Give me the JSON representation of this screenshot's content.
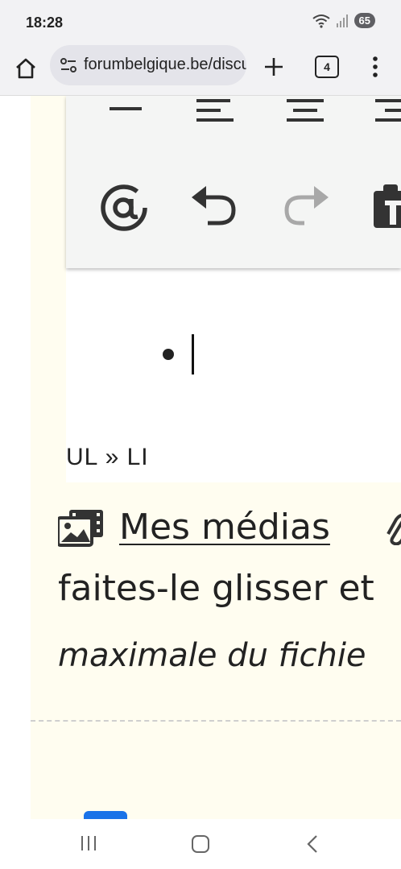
{
  "status_bar": {
    "time": "18:28",
    "battery": "65"
  },
  "browser": {
    "url": "forumbelgique.be/discussion",
    "tab_count": "4"
  },
  "editor": {
    "toolbar_icons": [
      "horizontal-rule-icon",
      "align-left-icon",
      "align-center-icon",
      "align-right-icon",
      "at-mention-icon",
      "undo-icon",
      "redo-icon",
      "paste-icon"
    ],
    "element_path": "UL » LI"
  },
  "attachments": {
    "media_link": "Mes médias",
    "drag_text": "faites-le glisser et",
    "size_text": "maximale du fichie"
  },
  "colors": {
    "cream_background": "#fffdf0",
    "accent_blue": "#1a73e8"
  }
}
